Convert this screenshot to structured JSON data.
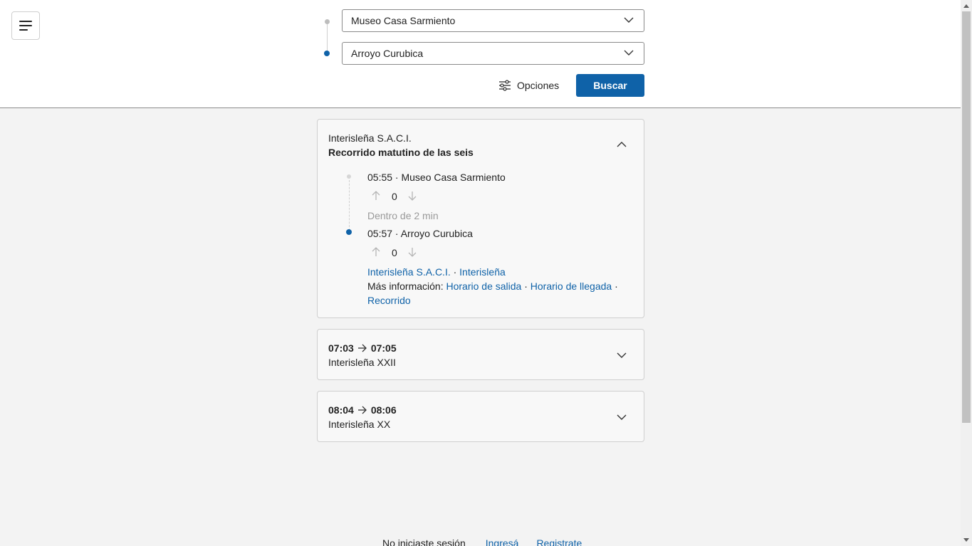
{
  "search": {
    "origin": "Museo Casa Sarmiento",
    "destination": "Arroyo Curubica",
    "options_label": "Opciones",
    "search_label": "Buscar"
  },
  "results": {
    "expanded": {
      "company": "Interisleña S.A.C.I.",
      "route_name": "Recorrido matutino de las seis",
      "departure": {
        "label": "05:55 · Museo Casa Sarmiento",
        "votes": "0"
      },
      "duration": "Dentro de 2 min",
      "arrival": {
        "label": "05:57 · Arroyo Curubica",
        "votes": "0"
      },
      "operator_link": "Interisleña S.A.C.I.",
      "separator": "·",
      "line_link": "Interisleña",
      "more_info_label": "Más información:",
      "departure_schedule_link": "Horario de salida",
      "arrival_schedule_link": "Horario de llegada",
      "route_link": "Recorrido"
    },
    "collapsed": [
      {
        "from": "07:03",
        "to": "07:05",
        "name": "Interisleña XXII"
      },
      {
        "from": "08:04",
        "to": "08:06",
        "name": "Interisleña XX"
      }
    ]
  },
  "footer": {
    "not_logged_text": "No iniciaste sesión",
    "login_link": "Ingresá",
    "register_link": "Registrate"
  },
  "colors": {
    "accent": "#0f62a8",
    "border": "#cfcfcf",
    "background": "#f3f3f3"
  },
  "icons": {
    "menu": "hamburger-menu-icon",
    "dropdown": "chevron-down-icon",
    "options": "sliders-icon",
    "collapse": "chevron-up-icon",
    "expand": "chevron-down-icon",
    "upvote": "arrow-up-icon",
    "downvote": "arrow-down-icon",
    "arrow": "arrow-right-icon"
  }
}
